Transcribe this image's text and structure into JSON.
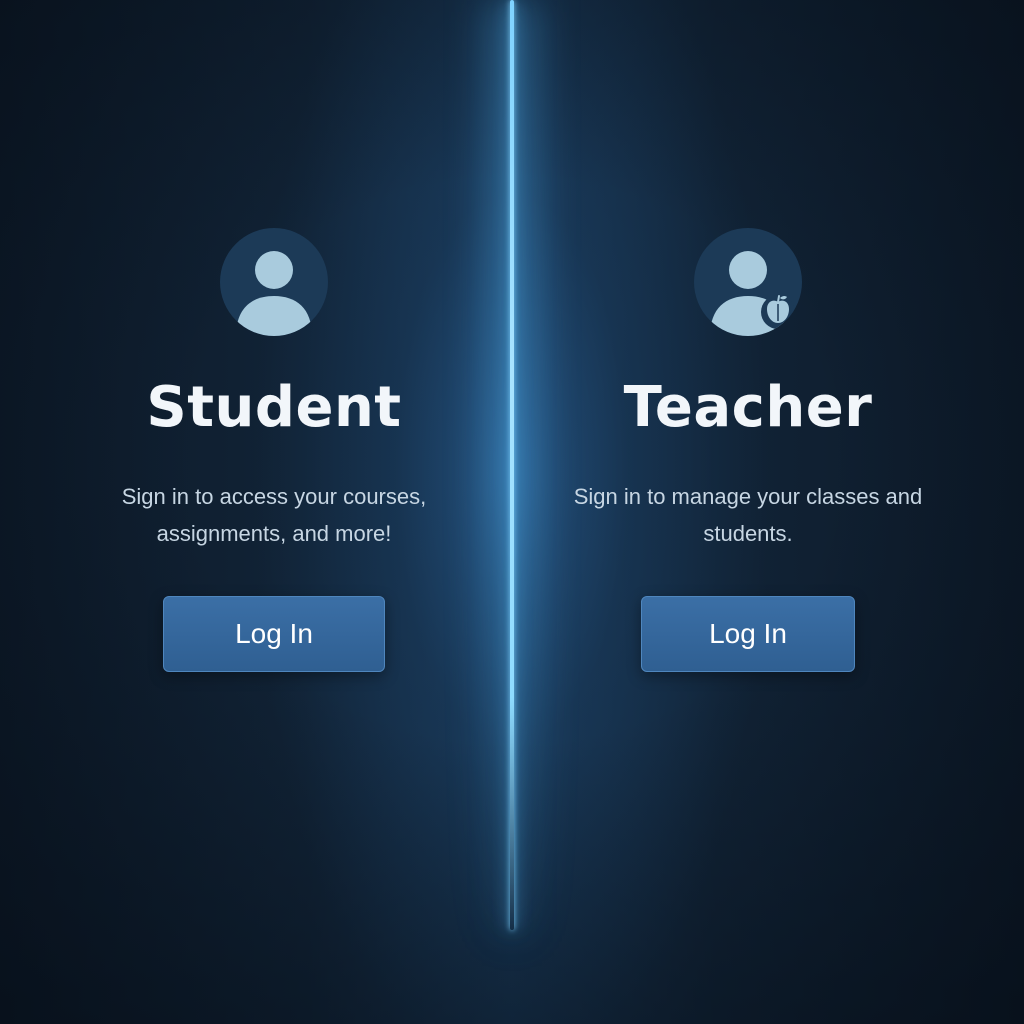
{
  "colors": {
    "background": "#0c1826",
    "divider_glow": "#7fd3ff",
    "avatar_circle": "#1c3a57",
    "avatar_figure": "#a9cbdd",
    "button": "#3367a0",
    "title_text": "#f2f6fa",
    "body_text": "#c7d6e3"
  },
  "student": {
    "avatar_icon": "student-avatar-icon",
    "title": "Student",
    "description": "Sign in to access your courses, assignments, and more!",
    "button_label": "Log In"
  },
  "teacher": {
    "avatar_icon": "teacher-avatar-icon",
    "badge_icon": "apple-icon",
    "title": "Teacher",
    "description": "Sign in to manage your classes and students.",
    "button_label": "Log In"
  }
}
